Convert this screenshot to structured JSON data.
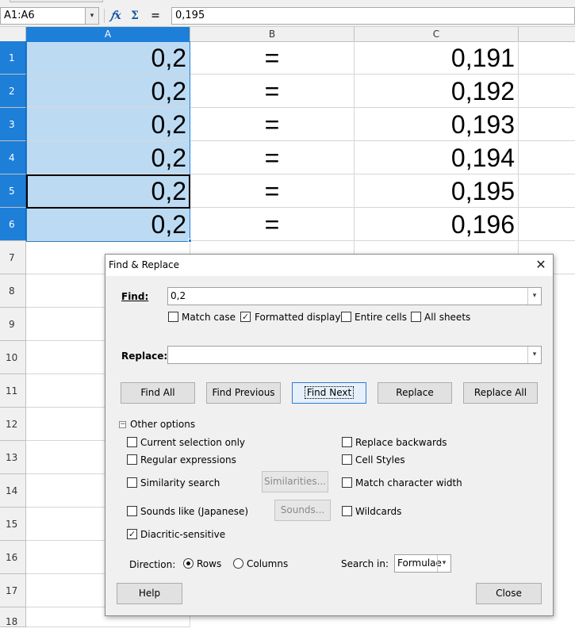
{
  "formula_bar": {
    "name_box": "A1:A6",
    "name_box_dropdown": "▾",
    "function_wizard_icon": "𝑓x",
    "sum_icon": "Σ",
    "equals_icon": "=",
    "formula_value": "0,195"
  },
  "columns": [
    "A",
    "B",
    "C"
  ],
  "rows": [
    {
      "num": "1",
      "a": "0,2",
      "b": "=",
      "c": "0,191"
    },
    {
      "num": "2",
      "a": "0,2",
      "b": "=",
      "c": "0,192"
    },
    {
      "num": "3",
      "a": "0,2",
      "b": "=",
      "c": "0,193"
    },
    {
      "num": "4",
      "a": "0,2",
      "b": "=",
      "c": "0,194"
    },
    {
      "num": "5",
      "a": "0,2",
      "b": "=",
      "c": "0,195"
    },
    {
      "num": "6",
      "a": "0,2",
      "b": "=",
      "c": "0,196"
    }
  ],
  "empty_rows": [
    "7",
    "8",
    "9",
    "10",
    "11",
    "12",
    "13",
    "14",
    "15",
    "16",
    "17",
    "18"
  ],
  "colors": {
    "selection_header": "#1e7fd8",
    "selection_fill": "#bcdbf3"
  },
  "dialog": {
    "title": "Find & Replace",
    "close_icon": "✕",
    "find_label": "Find:",
    "find_value": "0,2",
    "match_case": "Match case",
    "match_case_checked": false,
    "formatted_display": "Formatted display",
    "formatted_display_checked": true,
    "entire_cells": "Entire cells",
    "entire_cells_checked": false,
    "all_sheets": "All sheets",
    "all_sheets_checked": false,
    "replace_label": "Replace:",
    "replace_value": "",
    "buttons": {
      "find_all": "Find All",
      "find_previous": "Find Previous",
      "find_next": "Find Next",
      "replace": "Replace",
      "replace_all": "Replace All"
    },
    "other_options": "Other options",
    "options": {
      "current_selection_only": "Current selection only",
      "regular_expressions": "Regular expressions",
      "similarity_search": "Similarity search",
      "similarities_button": "Similarities...",
      "sounds_like": "Sounds like (Japanese)",
      "sounds_button": "Sounds...",
      "diacritic_sensitive": "Diacritic-sensitive",
      "diacritic_sensitive_checked": true,
      "replace_backwards": "Replace backwards",
      "cell_styles": "Cell Styles",
      "match_character_width": "Match character width",
      "wildcards": "Wildcards"
    },
    "direction_label": "Direction:",
    "direction_rows": "Rows",
    "direction_columns": "Columns",
    "direction_selected": "Rows",
    "search_in_label": "Search in:",
    "search_in_value": "Formulae",
    "help": "Help",
    "close": "Close"
  }
}
